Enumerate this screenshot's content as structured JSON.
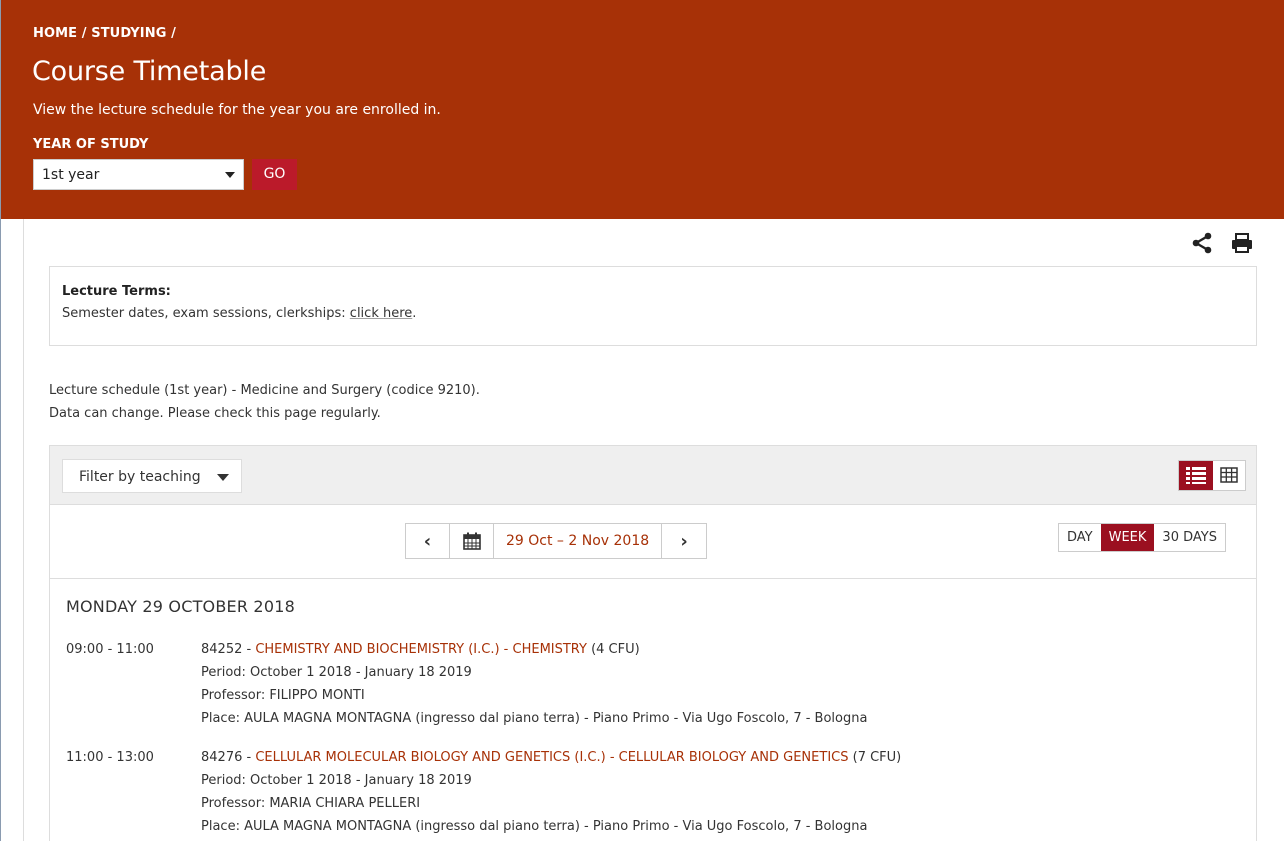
{
  "header": {
    "breadcrumb": "HOME / STUDYING /",
    "title": "Course Timetable",
    "subtitle": "View the lecture schedule for the year you are enrolled in.",
    "year_label": "YEAR OF STUDY",
    "year_selected": "1st year",
    "go_label": "GO"
  },
  "icons": {
    "share": "share-icon",
    "print": "print-icon"
  },
  "terms": {
    "heading": "Lecture Terms:",
    "text": "Semester dates, exam sessions, clerkships: ",
    "link": "click here",
    "after": "."
  },
  "description": {
    "line1": "Lecture schedule (1st year) - Medicine and Surgery (codice 9210).",
    "line2": "Data can change. Please check this page regularly."
  },
  "toolbar": {
    "filter_label": "Filter by teaching",
    "date_range": "29 Oct – 2 Nov 2018",
    "modes": [
      "DAY",
      "WEEK",
      "30 DAYS"
    ],
    "active_mode": "WEEK"
  },
  "schedule": {
    "day_heading": "MONDAY 29 OCTOBER 2018",
    "lessons": [
      {
        "time": "09:00 - 11:00",
        "code": "84252 - ",
        "course": "CHEMISTRY AND BIOCHEMISTRY (I.C.) - CHEMISTRY",
        "credits": " (4 CFU)",
        "period": "Period: October 1 2018 - January 18 2019",
        "professor": "Professor: FILIPPO MONTI",
        "place": "Place: AULA MAGNA MONTAGNA (ingresso dal piano terra) - Piano Primo - Via Ugo Foscolo, 7 - Bologna"
      },
      {
        "time": "11:00 - 13:00",
        "code": "84276 - ",
        "course": "CELLULAR MOLECULAR BIOLOGY AND GENETICS (I.C.) - CELLULAR BIOLOGY AND GENETICS",
        "credits": " (7 CFU)",
        "period": "Period: October 1 2018 - January 18 2019",
        "professor": "Professor: MARIA CHIARA PELLERI",
        "place": "Place: AULA MAGNA MONTAGNA (ingresso dal piano terra) - Piano Primo - Via Ugo Foscolo, 7 - Bologna"
      }
    ]
  },
  "colors": {
    "brand": "#a73107",
    "accent": "#9b1020",
    "go": "#bb1a2a"
  }
}
